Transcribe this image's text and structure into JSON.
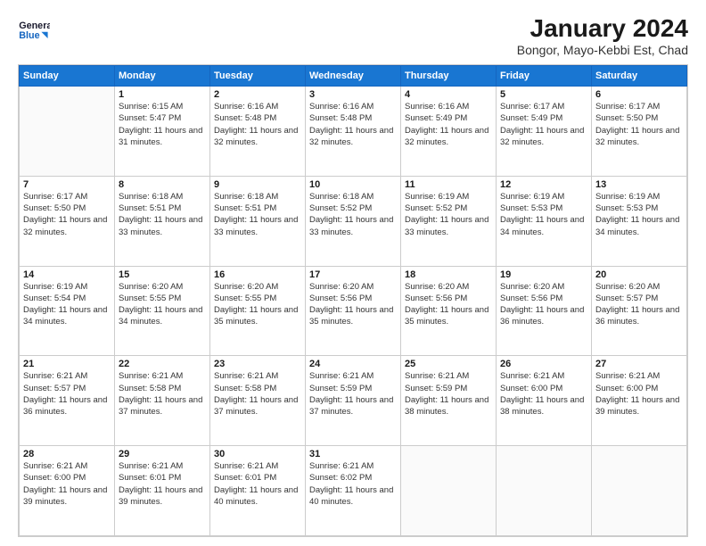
{
  "header": {
    "logo_line1": "General",
    "logo_line2": "Blue",
    "title": "January 2024",
    "subtitle": "Bongor, Mayo-Kebbi Est, Chad"
  },
  "calendar": {
    "days_of_week": [
      "Sunday",
      "Monday",
      "Tuesday",
      "Wednesday",
      "Thursday",
      "Friday",
      "Saturday"
    ],
    "weeks": [
      [
        {
          "day": "",
          "sunrise": "",
          "sunset": "",
          "daylight": ""
        },
        {
          "day": "1",
          "sunrise": "Sunrise: 6:15 AM",
          "sunset": "Sunset: 5:47 PM",
          "daylight": "Daylight: 11 hours and 31 minutes."
        },
        {
          "day": "2",
          "sunrise": "Sunrise: 6:16 AM",
          "sunset": "Sunset: 5:48 PM",
          "daylight": "Daylight: 11 hours and 32 minutes."
        },
        {
          "day": "3",
          "sunrise": "Sunrise: 6:16 AM",
          "sunset": "Sunset: 5:48 PM",
          "daylight": "Daylight: 11 hours and 32 minutes."
        },
        {
          "day": "4",
          "sunrise": "Sunrise: 6:16 AM",
          "sunset": "Sunset: 5:49 PM",
          "daylight": "Daylight: 11 hours and 32 minutes."
        },
        {
          "day": "5",
          "sunrise": "Sunrise: 6:17 AM",
          "sunset": "Sunset: 5:49 PM",
          "daylight": "Daylight: 11 hours and 32 minutes."
        },
        {
          "day": "6",
          "sunrise": "Sunrise: 6:17 AM",
          "sunset": "Sunset: 5:50 PM",
          "daylight": "Daylight: 11 hours and 32 minutes."
        }
      ],
      [
        {
          "day": "7",
          "sunrise": "Sunrise: 6:17 AM",
          "sunset": "Sunset: 5:50 PM",
          "daylight": "Daylight: 11 hours and 32 minutes."
        },
        {
          "day": "8",
          "sunrise": "Sunrise: 6:18 AM",
          "sunset": "Sunset: 5:51 PM",
          "daylight": "Daylight: 11 hours and 33 minutes."
        },
        {
          "day": "9",
          "sunrise": "Sunrise: 6:18 AM",
          "sunset": "Sunset: 5:51 PM",
          "daylight": "Daylight: 11 hours and 33 minutes."
        },
        {
          "day": "10",
          "sunrise": "Sunrise: 6:18 AM",
          "sunset": "Sunset: 5:52 PM",
          "daylight": "Daylight: 11 hours and 33 minutes."
        },
        {
          "day": "11",
          "sunrise": "Sunrise: 6:19 AM",
          "sunset": "Sunset: 5:52 PM",
          "daylight": "Daylight: 11 hours and 33 minutes."
        },
        {
          "day": "12",
          "sunrise": "Sunrise: 6:19 AM",
          "sunset": "Sunset: 5:53 PM",
          "daylight": "Daylight: 11 hours and 34 minutes."
        },
        {
          "day": "13",
          "sunrise": "Sunrise: 6:19 AM",
          "sunset": "Sunset: 5:53 PM",
          "daylight": "Daylight: 11 hours and 34 minutes."
        }
      ],
      [
        {
          "day": "14",
          "sunrise": "Sunrise: 6:19 AM",
          "sunset": "Sunset: 5:54 PM",
          "daylight": "Daylight: 11 hours and 34 minutes."
        },
        {
          "day": "15",
          "sunrise": "Sunrise: 6:20 AM",
          "sunset": "Sunset: 5:55 PM",
          "daylight": "Daylight: 11 hours and 34 minutes."
        },
        {
          "day": "16",
          "sunrise": "Sunrise: 6:20 AM",
          "sunset": "Sunset: 5:55 PM",
          "daylight": "Daylight: 11 hours and 35 minutes."
        },
        {
          "day": "17",
          "sunrise": "Sunrise: 6:20 AM",
          "sunset": "Sunset: 5:56 PM",
          "daylight": "Daylight: 11 hours and 35 minutes."
        },
        {
          "day": "18",
          "sunrise": "Sunrise: 6:20 AM",
          "sunset": "Sunset: 5:56 PM",
          "daylight": "Daylight: 11 hours and 35 minutes."
        },
        {
          "day": "19",
          "sunrise": "Sunrise: 6:20 AM",
          "sunset": "Sunset: 5:56 PM",
          "daylight": "Daylight: 11 hours and 36 minutes."
        },
        {
          "day": "20",
          "sunrise": "Sunrise: 6:20 AM",
          "sunset": "Sunset: 5:57 PM",
          "daylight": "Daylight: 11 hours and 36 minutes."
        }
      ],
      [
        {
          "day": "21",
          "sunrise": "Sunrise: 6:21 AM",
          "sunset": "Sunset: 5:57 PM",
          "daylight": "Daylight: 11 hours and 36 minutes."
        },
        {
          "day": "22",
          "sunrise": "Sunrise: 6:21 AM",
          "sunset": "Sunset: 5:58 PM",
          "daylight": "Daylight: 11 hours and 37 minutes."
        },
        {
          "day": "23",
          "sunrise": "Sunrise: 6:21 AM",
          "sunset": "Sunset: 5:58 PM",
          "daylight": "Daylight: 11 hours and 37 minutes."
        },
        {
          "day": "24",
          "sunrise": "Sunrise: 6:21 AM",
          "sunset": "Sunset: 5:59 PM",
          "daylight": "Daylight: 11 hours and 37 minutes."
        },
        {
          "day": "25",
          "sunrise": "Sunrise: 6:21 AM",
          "sunset": "Sunset: 5:59 PM",
          "daylight": "Daylight: 11 hours and 38 minutes."
        },
        {
          "day": "26",
          "sunrise": "Sunrise: 6:21 AM",
          "sunset": "Sunset: 6:00 PM",
          "daylight": "Daylight: 11 hours and 38 minutes."
        },
        {
          "day": "27",
          "sunrise": "Sunrise: 6:21 AM",
          "sunset": "Sunset: 6:00 PM",
          "daylight": "Daylight: 11 hours and 39 minutes."
        }
      ],
      [
        {
          "day": "28",
          "sunrise": "Sunrise: 6:21 AM",
          "sunset": "Sunset: 6:00 PM",
          "daylight": "Daylight: 11 hours and 39 minutes."
        },
        {
          "day": "29",
          "sunrise": "Sunrise: 6:21 AM",
          "sunset": "Sunset: 6:01 PM",
          "daylight": "Daylight: 11 hours and 39 minutes."
        },
        {
          "day": "30",
          "sunrise": "Sunrise: 6:21 AM",
          "sunset": "Sunset: 6:01 PM",
          "daylight": "Daylight: 11 hours and 40 minutes."
        },
        {
          "day": "31",
          "sunrise": "Sunrise: 6:21 AM",
          "sunset": "Sunset: 6:02 PM",
          "daylight": "Daylight: 11 hours and 40 minutes."
        },
        {
          "day": "",
          "sunrise": "",
          "sunset": "",
          "daylight": ""
        },
        {
          "day": "",
          "sunrise": "",
          "sunset": "",
          "daylight": ""
        },
        {
          "day": "",
          "sunrise": "",
          "sunset": "",
          "daylight": ""
        }
      ]
    ]
  }
}
